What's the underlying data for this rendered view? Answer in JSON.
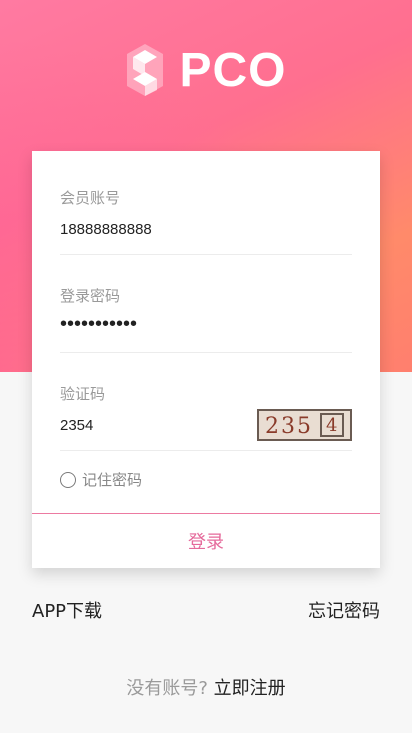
{
  "brand": {
    "name": "PCO",
    "logo_icon": "hexagon-logo-icon"
  },
  "form": {
    "account": {
      "label": "会员账号",
      "value": "18888888888"
    },
    "password": {
      "label": "登录密码",
      "value": "•••••••••••"
    },
    "captcha": {
      "label": "验证码",
      "value": "2354",
      "image_text": "235",
      "image_box_text": "4"
    },
    "remember": {
      "label": "记住密码",
      "checked": false
    },
    "submit_label": "登录"
  },
  "links": {
    "app_download": "APP下载",
    "forgot_password": "忘记密码"
  },
  "register": {
    "question": "没有账号?",
    "link": "立即注册"
  },
  "colors": {
    "hero_gradient_start": "#ff7aa2",
    "hero_gradient_end": "#ff8a6a",
    "accent_pink": "#e56a9b",
    "background": "#f7f7f7"
  }
}
